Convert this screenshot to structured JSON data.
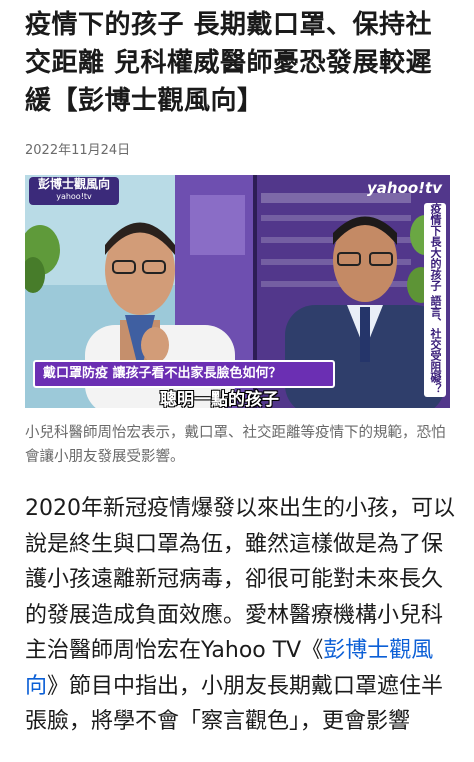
{
  "article": {
    "headline": "疫情下的孩子 長期戴口罩、保持社交距離 兒科權威醫師憂恐發展較遲緩【彭博士觀風向】",
    "date": "2022年11月24日"
  },
  "photo": {
    "show_logo": "彭博士觀風向",
    "show_logo_sub": "yahoo!tv",
    "brand": "yahoo!tv",
    "side_banner": "疫情下長大的孩子 語言、社交受阻礙？",
    "banner_main": "戴口罩防疫 讓孩子看不出家長臉色如何？",
    "subtitle": "聰明一點的孩子",
    "colors": {
      "banner_purple": "#6b2fb3",
      "studio_purple": "#5b3d97"
    }
  },
  "caption": "小兒科醫師周怡宏表示，戴口罩、社交距離等疫情下的規範，恐怕會讓小朋友發展受影響。",
  "body": {
    "text_before": "2020年新冠疫情爆發以來出生的小孩，可以說是終生與口罩為伍，雖然這樣做是為了保護小孩遠離新冠病毒，卻很可能對未來長久的發展造成負面效應。愛林醫療機構小兒科主治醫師周怡宏在Yahoo TV《",
    "link_text": "彭博士觀風向",
    "text_after": "》節目中指出，小朋友長期戴口罩遮住半張臉，將學不會「察言觀色」，更會影響"
  }
}
